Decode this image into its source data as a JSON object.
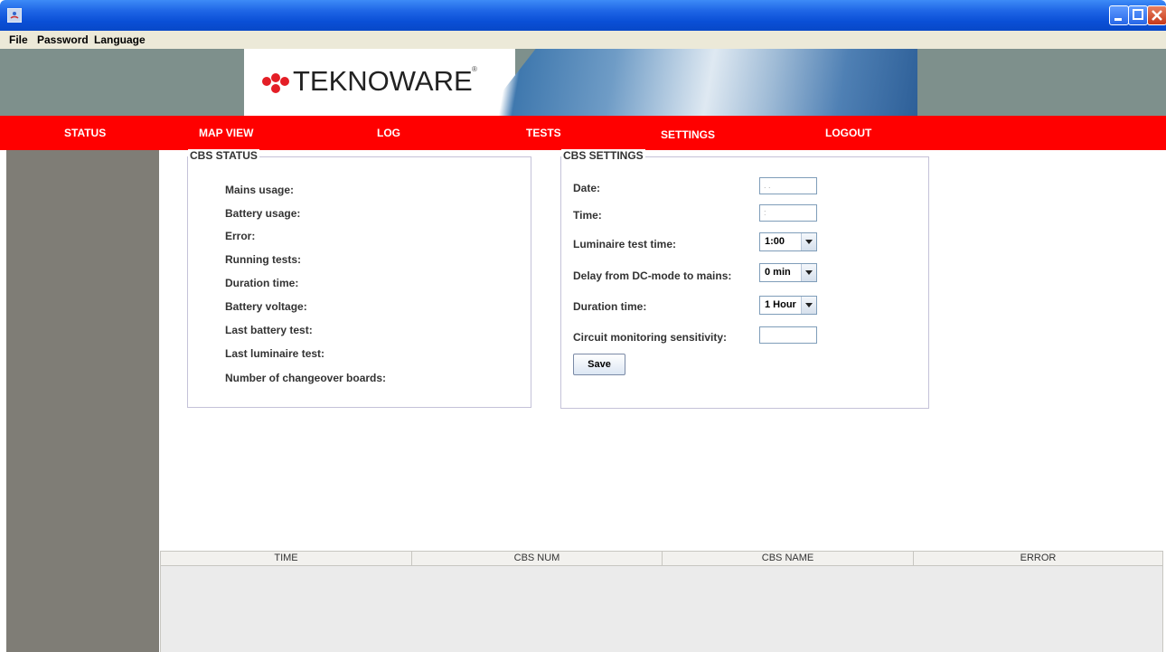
{
  "window": {
    "icon": "java-app-icon"
  },
  "menubar": {
    "items": [
      "File",
      "Password",
      "Language"
    ]
  },
  "banner": {
    "logo_text": "TEKNOWARE",
    "logo_mark": "®"
  },
  "nav": {
    "items": [
      "STATUS",
      "MAP VIEW",
      "LOG",
      "TESTS",
      "SETTINGS",
      "LOGOUT"
    ]
  },
  "cbs_status": {
    "title": "CBS STATUS",
    "labels": [
      "Mains usage:",
      "Battery usage:",
      "Error:",
      "Running tests:",
      "Duration time:",
      "Battery voltage:",
      "Last battery test:",
      "Last luminaire test:",
      "Number of changeover boards:"
    ]
  },
  "cbs_settings": {
    "title": "CBS SETTINGS",
    "date_label": "Date:",
    "date_value": ". .",
    "time_label": "Time:",
    "time_value": ":",
    "luminaire_label": "Luminaire test time:",
    "luminaire_value": "1:00",
    "delay_label": "Delay from DC-mode to mains:",
    "delay_value": "0 min",
    "duration_label": "Duration time:",
    "duration_value": "1 Hour",
    "sensitivity_label": "Circuit monitoring sensitivity:",
    "sensitivity_value": "",
    "save_label": "Save"
  },
  "table": {
    "columns": [
      "TIME",
      "CBS NUM",
      "CBS NAME",
      "ERROR"
    ]
  },
  "colors": {
    "nav_bg": "#ff0000",
    "titlebar": "#0a4fd6",
    "sidebar": "#7f7d76",
    "banner": "#7e908c"
  }
}
